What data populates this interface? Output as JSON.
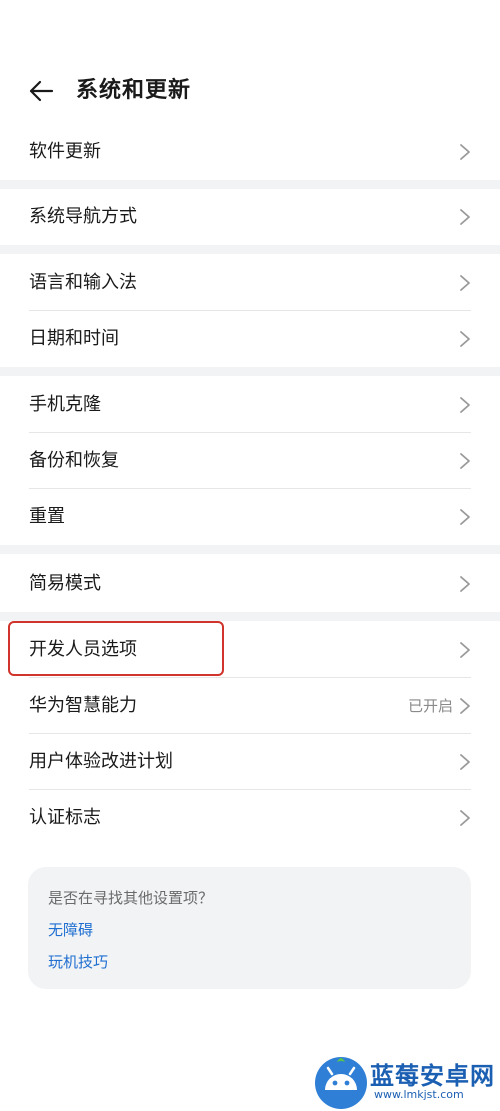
{
  "header": {
    "title": "系统和更新"
  },
  "groups": [
    {
      "items": [
        {
          "label": "软件更新",
          "value": ""
        }
      ]
    },
    {
      "items": [
        {
          "label": "系统导航方式",
          "value": ""
        }
      ]
    },
    {
      "items": [
        {
          "label": "语言和输入法",
          "value": ""
        },
        {
          "label": "日期和时间",
          "value": ""
        }
      ]
    },
    {
      "items": [
        {
          "label": "手机克隆",
          "value": ""
        },
        {
          "label": "备份和恢复",
          "value": ""
        },
        {
          "label": "重置",
          "value": ""
        }
      ]
    },
    {
      "items": [
        {
          "label": "简易模式",
          "value": ""
        }
      ]
    },
    {
      "items": [
        {
          "label": "开发人员选项",
          "value": "",
          "highlighted": true
        },
        {
          "label": "华为智慧能力",
          "value": "已开启"
        },
        {
          "label": "用户体验改进计划",
          "value": ""
        },
        {
          "label": "认证标志",
          "value": ""
        }
      ]
    }
  ],
  "suggestion": {
    "title": "是否在寻找其他设置项？",
    "links": [
      "无障碍",
      "玩机技巧"
    ]
  },
  "watermark": {
    "name": "蓝莓安卓网",
    "url": "www.lmkjst.com"
  },
  "colors": {
    "link": "#1f6fd1",
    "separator": "#f1f3f5",
    "highlight": "#d0342c",
    "watermark": "#1b5fb3"
  }
}
